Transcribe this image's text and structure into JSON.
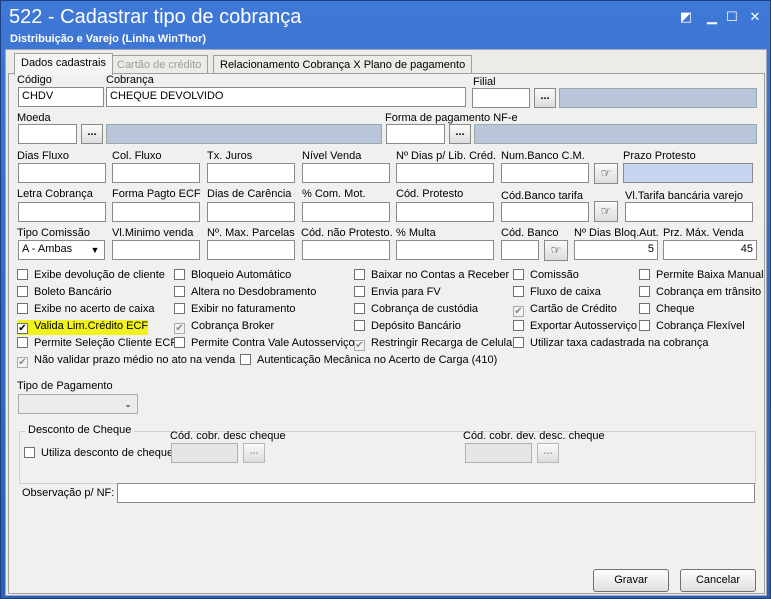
{
  "window": {
    "title": "522 - Cadastrar tipo de cobrança",
    "subtitle": "Distribuição e Varejo (Linha WinThor)"
  },
  "tabs": [
    "Dados cadastrais",
    "Cartão de crédito",
    "Relacionamento Cobrança X Plano de pagamento"
  ],
  "fields": {
    "codigo": {
      "label": "Código",
      "value": "CHDV"
    },
    "cobranca": {
      "label": "Cobrança",
      "value": "CHEQUE DEVOLVIDO"
    },
    "filial": {
      "label": "Filial"
    },
    "moeda": {
      "label": "Moeda"
    },
    "forma_nfe": {
      "label": "Forma de pagamento NF-e"
    },
    "dias_fluxo": {
      "label": "Dias Fluxo"
    },
    "col_fluxo": {
      "label": "Col. Fluxo"
    },
    "tx_juros": {
      "label": "Tx. Juros"
    },
    "nivel_venda": {
      "label": "Nível Venda"
    },
    "n_dias_lib": {
      "label": "Nº Dias p/ Lib. Créd."
    },
    "num_banco_cm": {
      "label": "Num.Banco C.M."
    },
    "prazo_protesto": {
      "label": "Prazo Protesto"
    },
    "letra_cobranca": {
      "label": "Letra Cobrança"
    },
    "forma_pagto_ecf": {
      "label": "Forma Pagto ECF"
    },
    "dias_carencia": {
      "label": "Dias de Carência"
    },
    "com_mot": {
      "label": "% Com. Mot."
    },
    "cod_protesto": {
      "label": "Cód. Protesto"
    },
    "cod_banco_tarifa": {
      "label": "Cód.Banco tarifa"
    },
    "vl_tarifa": {
      "label": "Vl.Tarifa bancária varejo"
    },
    "tipo_comissao": {
      "label": "Tipo Comissão",
      "value": "A - Ambas"
    },
    "vl_minimo": {
      "label": "Vl.Minimo venda"
    },
    "max_parcelas": {
      "label": "Nº. Max. Parcelas"
    },
    "cod_nao_protesto": {
      "label": "Cód. não Protesto."
    },
    "multa": {
      "label": "% Multa"
    },
    "cod_banco": {
      "label": "Cód. Banco"
    },
    "dias_bloq": {
      "label": "Nº Dias Bloq.Aut.",
      "value": "5"
    },
    "prz_max_venda": {
      "label": "Prz. Máx. Venda",
      "value": "45"
    }
  },
  "checkboxes": {
    "col1": [
      {
        "label": "Exibe devolução de cliente",
        "checked": false
      },
      {
        "label": "Boleto Bancário",
        "checked": false
      },
      {
        "label": "Exibe no acerto de caixa",
        "checked": false
      },
      {
        "label": "Valida Lim.Crédito ECF",
        "checked": true
      },
      {
        "label": "Permite Seleção Cliente ECF",
        "checked": false
      }
    ],
    "col2": [
      {
        "label": "Bloqueio Automático",
        "checked": false
      },
      {
        "label": "Altera no Desdobramento",
        "checked": false
      },
      {
        "label": "Exibir no faturamento",
        "checked": false
      },
      {
        "label": "Cobrança Broker",
        "checked": true
      },
      {
        "label": "Permite Contra Vale Autosserviço",
        "checked": false
      }
    ],
    "col3": [
      {
        "label": "Baixar no Contas a Receber",
        "checked": false
      },
      {
        "label": "Envia para FV",
        "checked": false
      },
      {
        "label": "Cobrança de custódia",
        "checked": false
      },
      {
        "label": "Depósito Bancário",
        "checked": false
      },
      {
        "label": "Restringir Recarga de Celular",
        "checked": true
      }
    ],
    "col4": [
      {
        "label": "Comissão",
        "checked": false
      },
      {
        "label": "Fluxo de caixa",
        "checked": false
      },
      {
        "label": "Cartão de Crédito",
        "checked": true
      },
      {
        "label": "Exportar Autosserviço",
        "checked": false
      },
      {
        "label": "Utilizar taxa cadastrada na cobrança",
        "checked": false
      }
    ],
    "col5": [
      {
        "label": "Permite Baixa Manual",
        "checked": false
      },
      {
        "label": "Cobrança em trânsito",
        "checked": false
      },
      {
        "label": "Cheque",
        "checked": false
      },
      {
        "label": "Cobrança Flexível",
        "checked": false
      }
    ],
    "row6": [
      {
        "label": "Não validar prazo médio no ato na venda",
        "checked": true
      },
      {
        "label": "Autenticação Mecânica no Acerto de Carga (410)",
        "checked": false
      }
    ]
  },
  "tipo_pagamento": {
    "label": "Tipo de Pagamento"
  },
  "desconto": {
    "legend": "Desconto de Cheque",
    "checkbox": "Utiliza desconto de cheque",
    "cod_desc": "Cód. cobr. desc cheque",
    "cod_dev_desc": "Cód. cobr. dev. desc. cheque"
  },
  "observacao": {
    "label": "Observação p/ NF:"
  },
  "buttons": {
    "ellipsis": "...",
    "gravar": "Gravar",
    "cancelar": "Cancelar"
  },
  "colors": {
    "titlebar": "#3f78d6",
    "highlight": "#f0f21a",
    "readonly": "#b9c6d9"
  }
}
